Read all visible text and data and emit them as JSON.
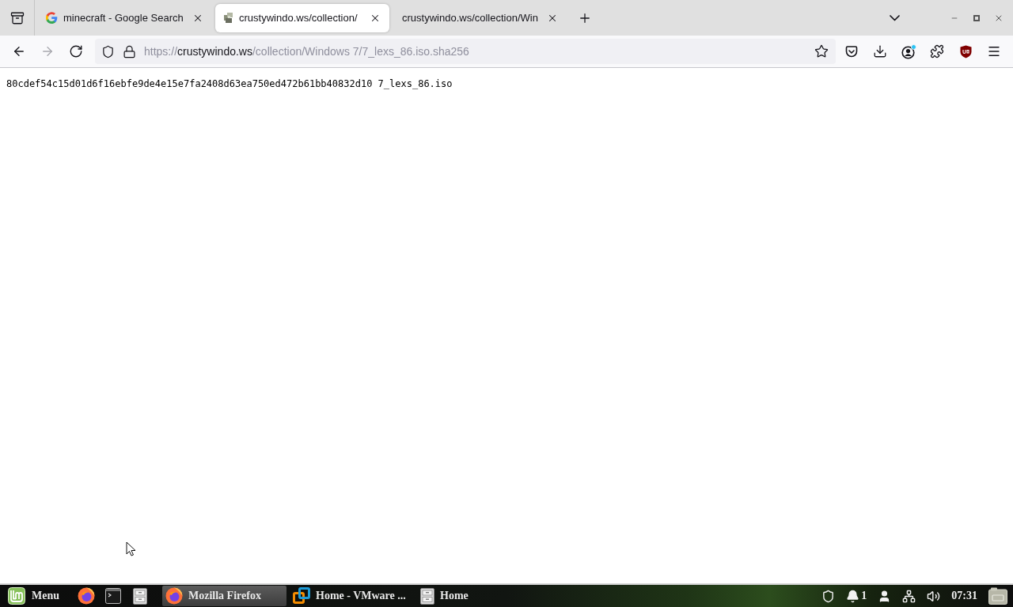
{
  "browser": {
    "tabs": [
      {
        "title": "minecraft - Google Search",
        "kind": "search",
        "selected": false
      },
      {
        "title": "crustywindo.ws/collection/",
        "kind": "page",
        "selected": true
      },
      {
        "title": "crustywindo.ws/collection/Win",
        "kind": "plain",
        "selected": false
      }
    ],
    "nav_buttons": [
      {
        "kind": "back",
        "disabled": false
      },
      {
        "kind": "forward",
        "disabled": true
      },
      {
        "kind": "reload",
        "disabled": false
      }
    ],
    "address": {
      "scheme": "https://",
      "host": "crustywindo.ws",
      "path": "/collection/Windows 7/7_lexs_86.iso.sha256",
      "bookmarked": false
    },
    "toolbar": [
      {
        "kind": "pocket"
      },
      {
        "kind": "downloads"
      },
      {
        "kind": "account",
        "badge": true
      },
      {
        "kind": "extensions"
      },
      {
        "kind": "ublock"
      },
      {
        "kind": "menu"
      }
    ]
  },
  "page": {
    "text": "80cdef54c15d01d6f16ebfe9de4e15e7fa2408d63ea750ed472b61bb40832d10 7_lexs_86.iso"
  },
  "taskbar": {
    "menu_label": "Menu",
    "launchers": [
      {
        "kind": "firefox"
      },
      {
        "kind": "terminal"
      },
      {
        "kind": "files"
      }
    ],
    "windows": [
      {
        "label": "Mozilla Firefox",
        "kind": "firefox",
        "selected": true
      },
      {
        "label": "Home - VMware ...",
        "kind": "vmware",
        "selected": false
      },
      {
        "label": "Home",
        "kind": "files",
        "selected": false
      }
    ],
    "tray": [
      {
        "kind": "shield"
      },
      {
        "kind": "notifications",
        "count": "1"
      },
      {
        "kind": "user"
      },
      {
        "kind": "network"
      },
      {
        "kind": "volume"
      },
      {
        "kind": "clock",
        "text": "07:31"
      },
      {
        "kind": "calendar"
      }
    ]
  }
}
